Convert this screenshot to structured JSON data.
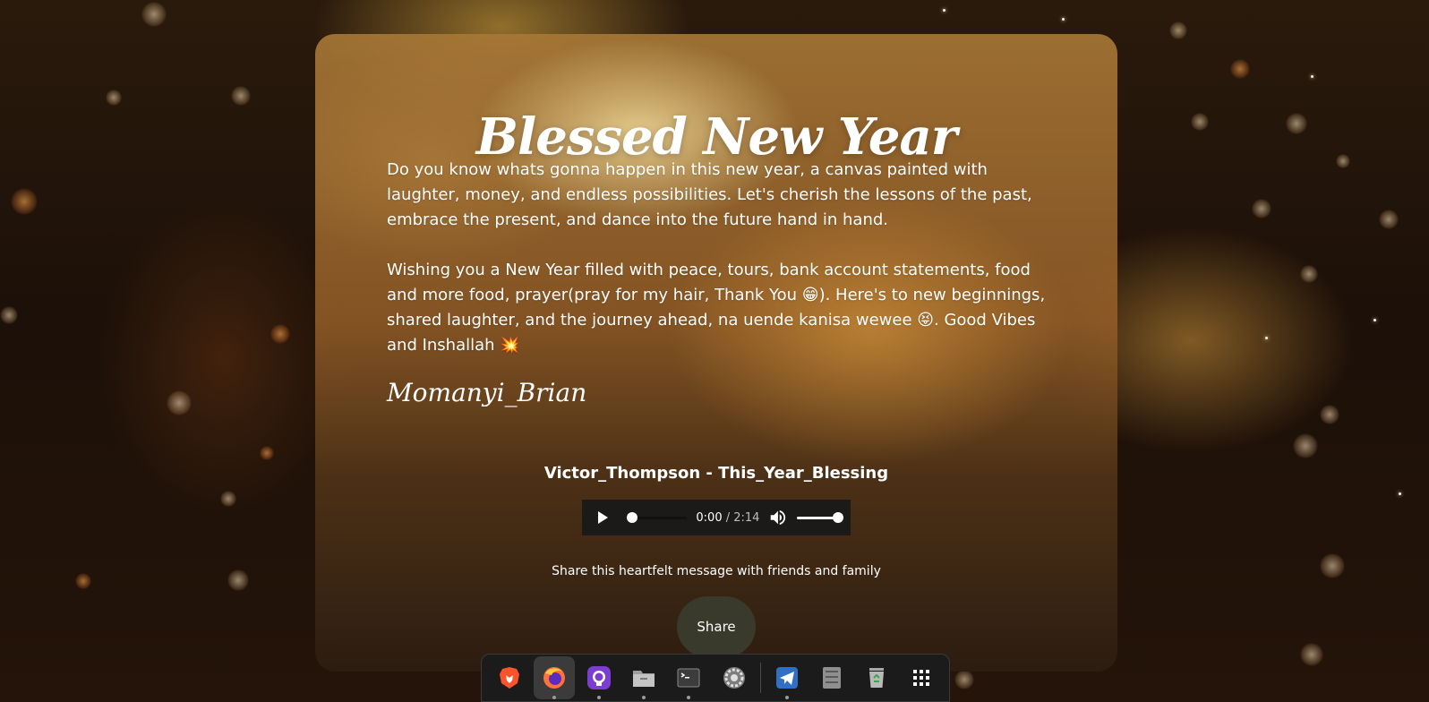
{
  "greeting": {
    "title": "Blessed New Year",
    "paragraph_1": "Do you know whats gonna happen in this new year, a canvas painted with laughter, money, and endless possibilities. Let's cherish the lessons of the past, embrace the present, and dance into the future hand in hand.",
    "paragraph_2": "Wishing you a New Year filled with peace, tours, bank account statements, food and more food, prayer(pray for my hair, Thank You 😁). Here's to new beginnings, shared laughter, and the journey ahead, na uende kanisa wewee 😝. Good Vibes and Inshallah 💥",
    "signature": "Momanyi_Brian"
  },
  "audio": {
    "track_title": "Victor_Thompson - This_Year_Blessing",
    "current_time": "0:00",
    "duration": "/ 2:14",
    "progress": 0,
    "volume": 1.0
  },
  "share": {
    "prompt": "Share this heartfelt message with friends and family",
    "button_label": "Share"
  },
  "dock": {
    "items": [
      {
        "name": "brave-browser-icon",
        "active": false,
        "running": false
      },
      {
        "name": "firefox-icon",
        "active": true,
        "running": true
      },
      {
        "name": "github-desktop-icon",
        "active": false,
        "running": true
      },
      {
        "name": "file-manager-icon",
        "active": false,
        "running": true
      },
      {
        "name": "terminal-icon",
        "active": false,
        "running": true
      },
      {
        "name": "settings-icon",
        "active": false,
        "running": false
      },
      {
        "name": "telegram-icon",
        "active": false,
        "running": true
      },
      {
        "name": "system-monitor-icon",
        "active": false,
        "running": false
      },
      {
        "name": "trash-icon",
        "active": false,
        "running": false
      },
      {
        "name": "app-grid-icon",
        "active": false,
        "running": false
      }
    ]
  },
  "colors": {
    "card_gold": "#a8783a",
    "player_bg": "#1c1a18",
    "share_button_bg": "#3a3a2c",
    "dock_bg": "#1b1b1b"
  }
}
